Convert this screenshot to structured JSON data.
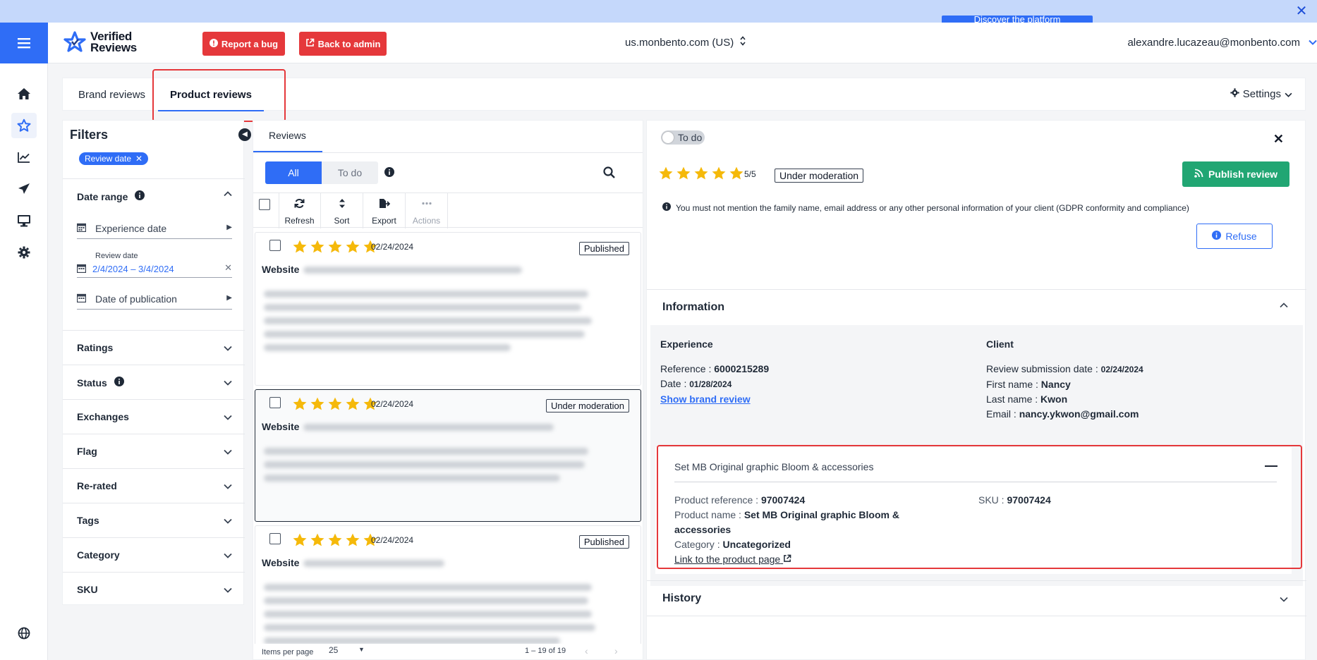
{
  "banner": {
    "button_label": "Discover the platform"
  },
  "header": {
    "logo_line1": "Verified",
    "logo_line2": "Reviews",
    "report_bug": "Report a bug",
    "back_admin": "Back to admin",
    "domain": "us.monbento.com (US)",
    "user_email": "alexandre.lucazeau@monbento.com"
  },
  "sidebar": {
    "items": [
      {
        "icon": "home-icon"
      },
      {
        "icon": "star-icon",
        "active": true
      },
      {
        "icon": "chart-icon"
      },
      {
        "icon": "send-icon"
      },
      {
        "icon": "monitor-icon"
      },
      {
        "icon": "gear-icon"
      },
      {
        "icon": "globe-icon"
      }
    ]
  },
  "tabs": {
    "brand": "Brand reviews",
    "product": "Product reviews",
    "settings": "Settings"
  },
  "filters": {
    "title": "Filters",
    "chip": "Review date",
    "date_range": "Date range",
    "experience_date": "Experience date",
    "review_date_label": "Review date",
    "review_date_value": "2/4/2024 – 3/4/2024",
    "date_of_publication": "Date of publication",
    "sections": [
      "Ratings",
      "Status",
      "Exchanges",
      "Flag",
      "Re-rated",
      "Tags",
      "Category",
      "SKU"
    ]
  },
  "reviews": {
    "tab": "Reviews",
    "seg_all": "All",
    "seg_todo": "To do",
    "tools": [
      "Refresh",
      "Sort",
      "Export",
      "Actions"
    ],
    "cards": [
      {
        "date": "02/24/2024",
        "status": "Published",
        "source": "Website",
        "rating": 5
      },
      {
        "date": "02/24/2024",
        "status": "Under moderation",
        "source": "Website",
        "rating": 5
      },
      {
        "date": "02/24/2024",
        "status": "Published",
        "source": "Website",
        "rating": 5
      }
    ],
    "items_per_page_label": "Items per page",
    "items_per_page": "25",
    "range": "1 – 19 of 19"
  },
  "detail": {
    "toggle": "To do",
    "rating_text": "5/5",
    "rating": 5,
    "status": "Under moderation",
    "publish": "Publish review",
    "gdpr": "You must not mention the family name, email address or any other personal information of your client (GDPR conformity and compliance)",
    "refuse": "Refuse",
    "information": "Information",
    "experience": {
      "heading": "Experience",
      "reference_label": "Reference : ",
      "reference": "6000215289",
      "date_label": "Date : ",
      "date": "01/28/2024",
      "brand_link": "Show brand review"
    },
    "client": {
      "heading": "Client",
      "submission_label": "Review submission date : ",
      "submission": "02/24/2024",
      "first_label": "First name : ",
      "first": "Nancy",
      "last_label": "Last name : ",
      "last": "Kwon",
      "email_label": "Email : ",
      "email": "nancy.ykwon@gmail.com"
    },
    "product": {
      "title": "Set MB Original graphic Bloom & accessories",
      "ref_label": "Product reference : ",
      "ref": "97007424",
      "name_label": "Product name : ",
      "name": "Set MB Original graphic Bloom & accessories",
      "category_label": "Category : ",
      "category": "Uncategorized",
      "link": "Link to the product page",
      "sku_label": "SKU : ",
      "sku": "97007424"
    },
    "history": "History"
  },
  "colors": {
    "accent": "#2f6df6",
    "danger": "#e5383b",
    "success": "#21a673",
    "star": "#f5b90a"
  }
}
